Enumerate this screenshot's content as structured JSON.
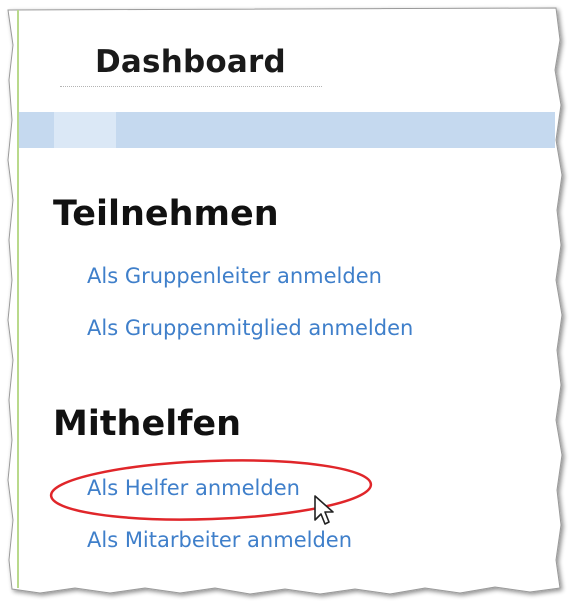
{
  "dashboard_tab": {
    "label": "Dashboard"
  },
  "sections": [
    {
      "heading": "Teilnehmen",
      "links": [
        "Als Gruppenleiter anmelden",
        "Als Gruppenmitglied anmelden"
      ]
    },
    {
      "heading": "Mithelfen",
      "links": [
        "Als Helfer anmelden",
        "Als Mitarbeiter anmelden"
      ]
    }
  ],
  "colors": {
    "link": "#3f7fca",
    "header_bar": "#c5d9ef",
    "highlight_ellipse": "#e0262a"
  },
  "annotation": {
    "highlighted_link": "Als Helfer anmelden",
    "cursor_icon": "arrow-pointer"
  }
}
